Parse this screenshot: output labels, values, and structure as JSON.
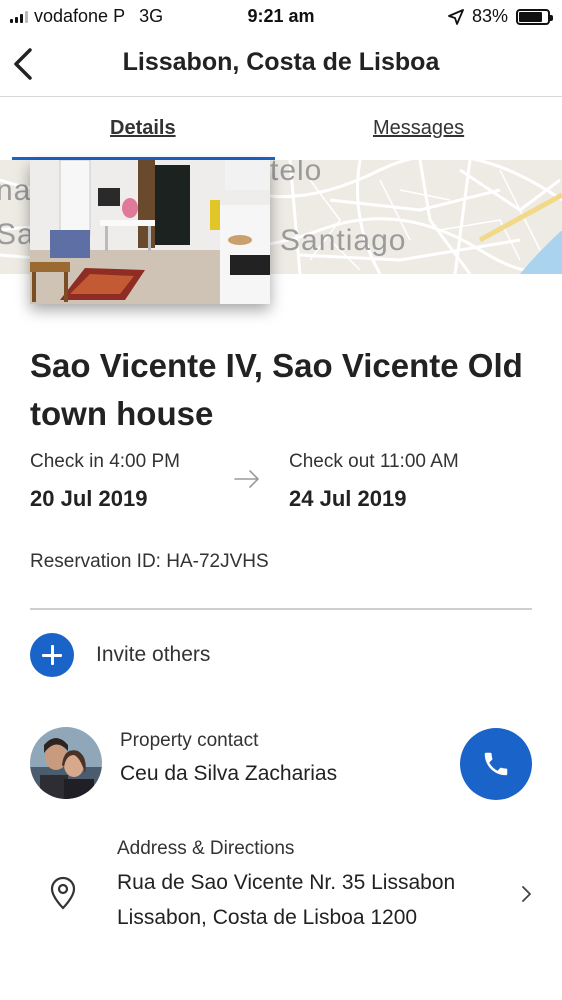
{
  "status_bar": {
    "carrier": "vodafone P",
    "network": "3G",
    "time": "9:21 am",
    "battery": "83%",
    "battery_level": 0.83
  },
  "header": {
    "title": "Lissabon, Costa de Lisboa"
  },
  "tabs": [
    {
      "label": "Details",
      "active": true
    },
    {
      "label": "Messages",
      "active": false
    }
  ],
  "map": {
    "labels": [
      "telo",
      "na",
      "Sa",
      "Santiago"
    ]
  },
  "property": {
    "title": "Sao Vicente IV, Sao Vicente Old town house",
    "checkin_label": "Check in 4:00 PM",
    "checkin_date": "20 Jul 2019",
    "checkout_label": "Check out 11:00 AM",
    "checkout_date": "24 Jul 2019",
    "reservation": "Reservation ID: HA-72JVHS"
  },
  "invite": {
    "label": "Invite others"
  },
  "contact": {
    "label": "Property contact",
    "name": "Ceu da Silva Zacharias"
  },
  "address": {
    "label": "Address & Directions",
    "line1": "Rua de Sao Vicente Nr. 35 Lissabon",
    "line2": "Lissabon, Costa de Lisboa 1200"
  },
  "colors": {
    "accent": "#1a63c9",
    "divider": "#cfcfcf"
  }
}
